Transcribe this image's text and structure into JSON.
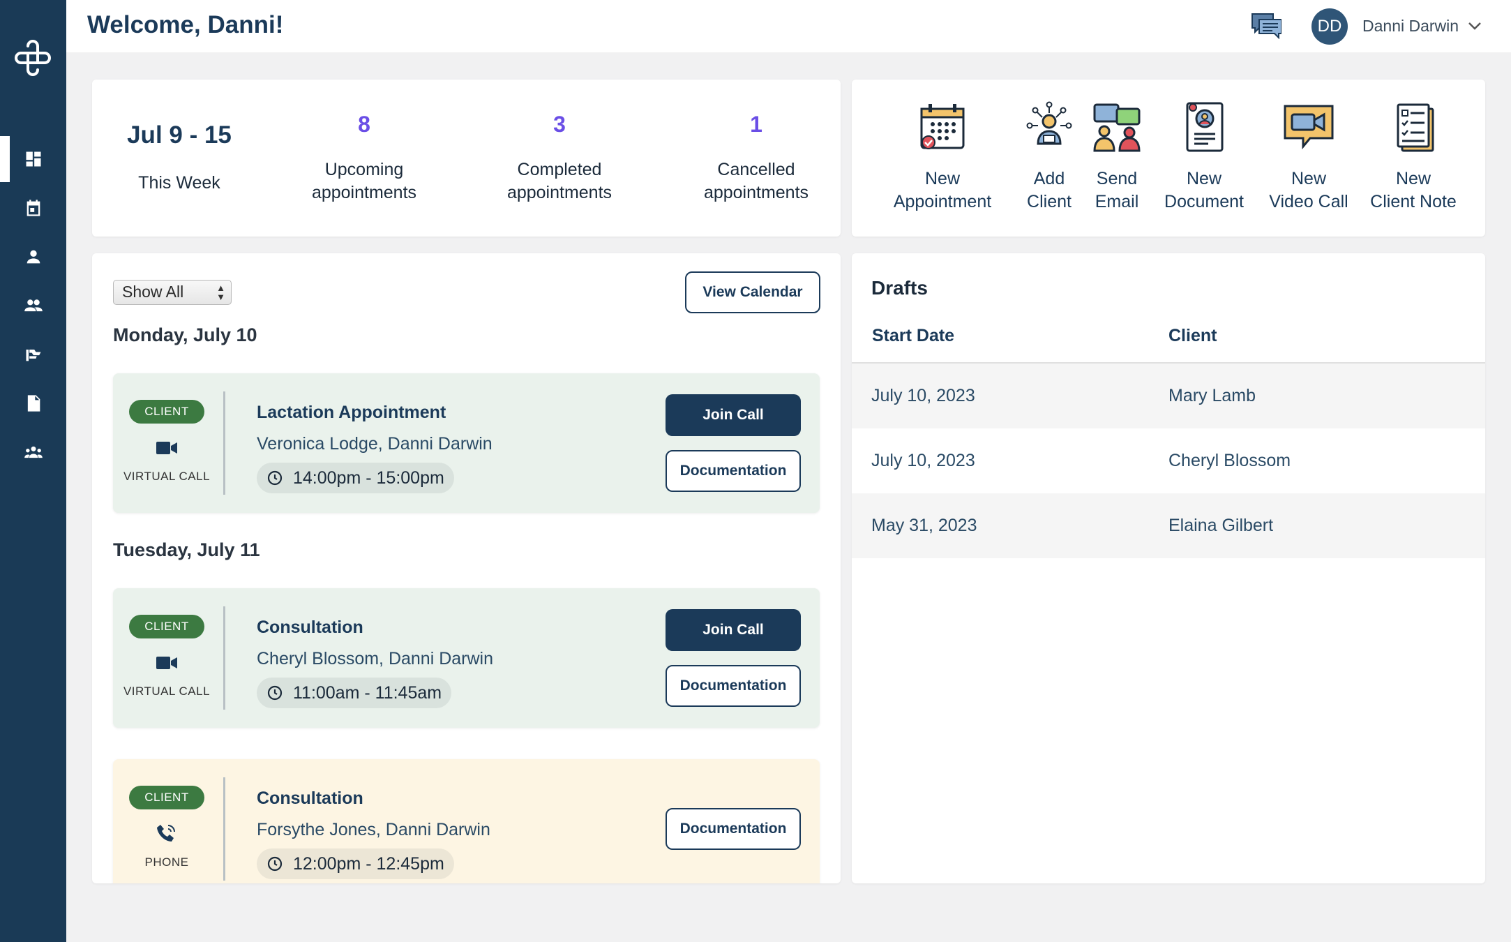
{
  "header": {
    "welcome": "Welcome, Danni!",
    "avatar_initials": "DD",
    "user_name": "Danni Darwin"
  },
  "sidebar": {
    "items": [
      {
        "icon": "dashboard-icon",
        "active": true
      },
      {
        "icon": "calendar-icon"
      },
      {
        "icon": "person-icon"
      },
      {
        "icon": "people-icon"
      },
      {
        "icon": "flag-icon"
      },
      {
        "icon": "document-icon"
      },
      {
        "icon": "group-icon"
      }
    ]
  },
  "stats": {
    "week_range": "Jul 9 - 15",
    "week_label": "This Week",
    "upcoming": {
      "count": "8",
      "label": "Upcoming appointments"
    },
    "completed": {
      "count": "3",
      "label": "Completed appointments"
    },
    "cancelled": {
      "count": "1",
      "label": "Cancelled appointments"
    }
  },
  "actions": [
    {
      "line1": "New",
      "line2": "Appointment",
      "icon": "calendar-add-icon"
    },
    {
      "line1": "Add",
      "line2": "Client",
      "icon": "add-client-icon"
    },
    {
      "line1": "Send",
      "line2": "Email",
      "icon": "send-email-icon"
    },
    {
      "line1": "New",
      "line2": "Document",
      "icon": "document-profile-icon"
    },
    {
      "line1": "New",
      "line2": "Video Call",
      "icon": "video-call-icon"
    },
    {
      "line1": "New",
      "line2": "Client Note",
      "icon": "client-note-icon"
    }
  ],
  "appointments": {
    "filter_value": "Show All",
    "view_calendar_label": "View Calendar",
    "days": [
      {
        "heading": "Monday, July 10",
        "items": [
          {
            "badge": "CLIENT",
            "type": "VIRTUAL CALL",
            "title": "Lactation Appointment",
            "people": "Veronica Lodge, Danni Darwin",
            "time": "14:00pm - 15:00pm",
            "join_label": "Join Call",
            "doc_label": "Documentation"
          }
        ]
      },
      {
        "heading": "Tuesday, July 11",
        "items": [
          {
            "badge": "CLIENT",
            "type": "VIRTUAL CALL",
            "title": "Consultation",
            "people": "Cheryl Blossom, Danni Darwin",
            "time": "11:00am - 11:45am",
            "join_label": "Join Call",
            "doc_label": "Documentation"
          },
          {
            "badge": "CLIENT",
            "type": "PHONE",
            "title": "Consultation",
            "people": "Forsythe Jones, Danni Darwin",
            "time": "12:00pm - 12:45pm",
            "doc_label": "Documentation"
          }
        ]
      }
    ]
  },
  "drafts": {
    "title": "Drafts",
    "columns": [
      "Start Date",
      "Client"
    ],
    "rows": [
      {
        "date": "July 10, 2023",
        "client": "Mary Lamb"
      },
      {
        "date": "July 10, 2023",
        "client": "Cheryl Blossom"
      },
      {
        "date": "May 31, 2023",
        "client": "Elaina Gilbert"
      }
    ]
  },
  "colors": {
    "sidebar": "#1a3a56",
    "accent_number": "#6a4ee6",
    "badge_green": "#3c7a41",
    "primary_button": "#1b3a59"
  }
}
